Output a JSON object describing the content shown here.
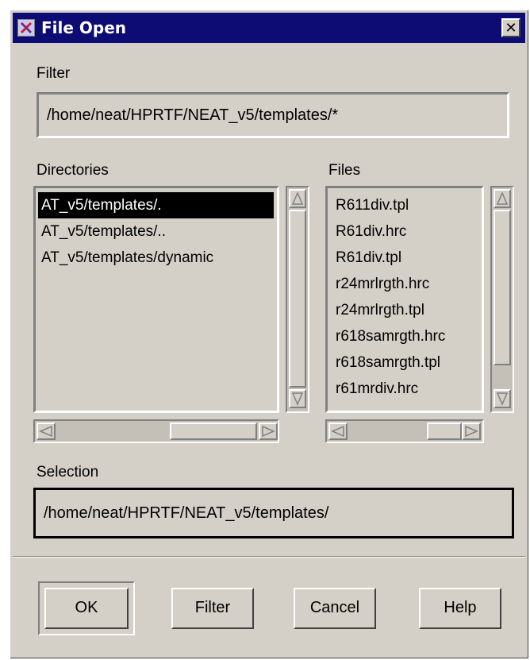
{
  "window": {
    "title": "File Open",
    "close_glyph": "✕",
    "title_icon": "app-x-icon",
    "titlebar_color": "#0c0c74"
  },
  "filter": {
    "label": "Filter",
    "value": "/home/neat/HPRTF/NEAT_v5/templates/*"
  },
  "directories": {
    "label": "Directories",
    "items": [
      "AT_v5/templates/.",
      "AT_v5/templates/..",
      "AT_v5/templates/dynamic"
    ],
    "selected_index": 0
  },
  "files": {
    "label": "Files",
    "items": [
      "R611div.tpl",
      "R61div.hrc",
      "R61div.tpl",
      "r24mrlrgth.hrc",
      "r24mrlrgth.tpl",
      "r618samrgth.hrc",
      "r618samrgth.tpl",
      "r61mrdiv.hrc"
    ]
  },
  "selection": {
    "label": "Selection",
    "value": "/home/neat/HPRTF/NEAT_v5/templates/"
  },
  "buttons": {
    "ok": "OK",
    "filter": "Filter",
    "cancel": "Cancel",
    "help": "Help"
  }
}
